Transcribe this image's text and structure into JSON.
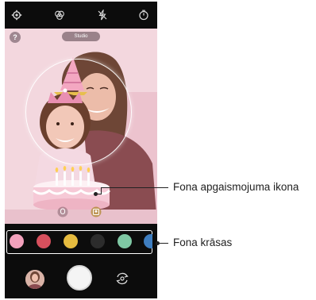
{
  "viewfinder": {
    "help_label": "?",
    "mode_label": "Studio"
  },
  "icons": {
    "top": [
      "settings-icon",
      "filter-icon",
      "flash-off-icon",
      "timer-icon"
    ],
    "viewfinder": [
      "help-icon",
      "face-lighting-icon",
      "background-lighting-icon"
    ],
    "bottom": [
      "gallery-thumbnail",
      "shutter-button",
      "switch-camera-icon"
    ]
  },
  "palette": {
    "colors": [
      "#f3a2bd",
      "#d7505d",
      "#e6bb3f",
      "#2c2c2c",
      "#7fc8a4",
      "#3f7ec0"
    ]
  },
  "callouts": {
    "background_lighting_icon": "Fona apgaismojuma ikona",
    "background_colors": "Fona krāsas"
  }
}
